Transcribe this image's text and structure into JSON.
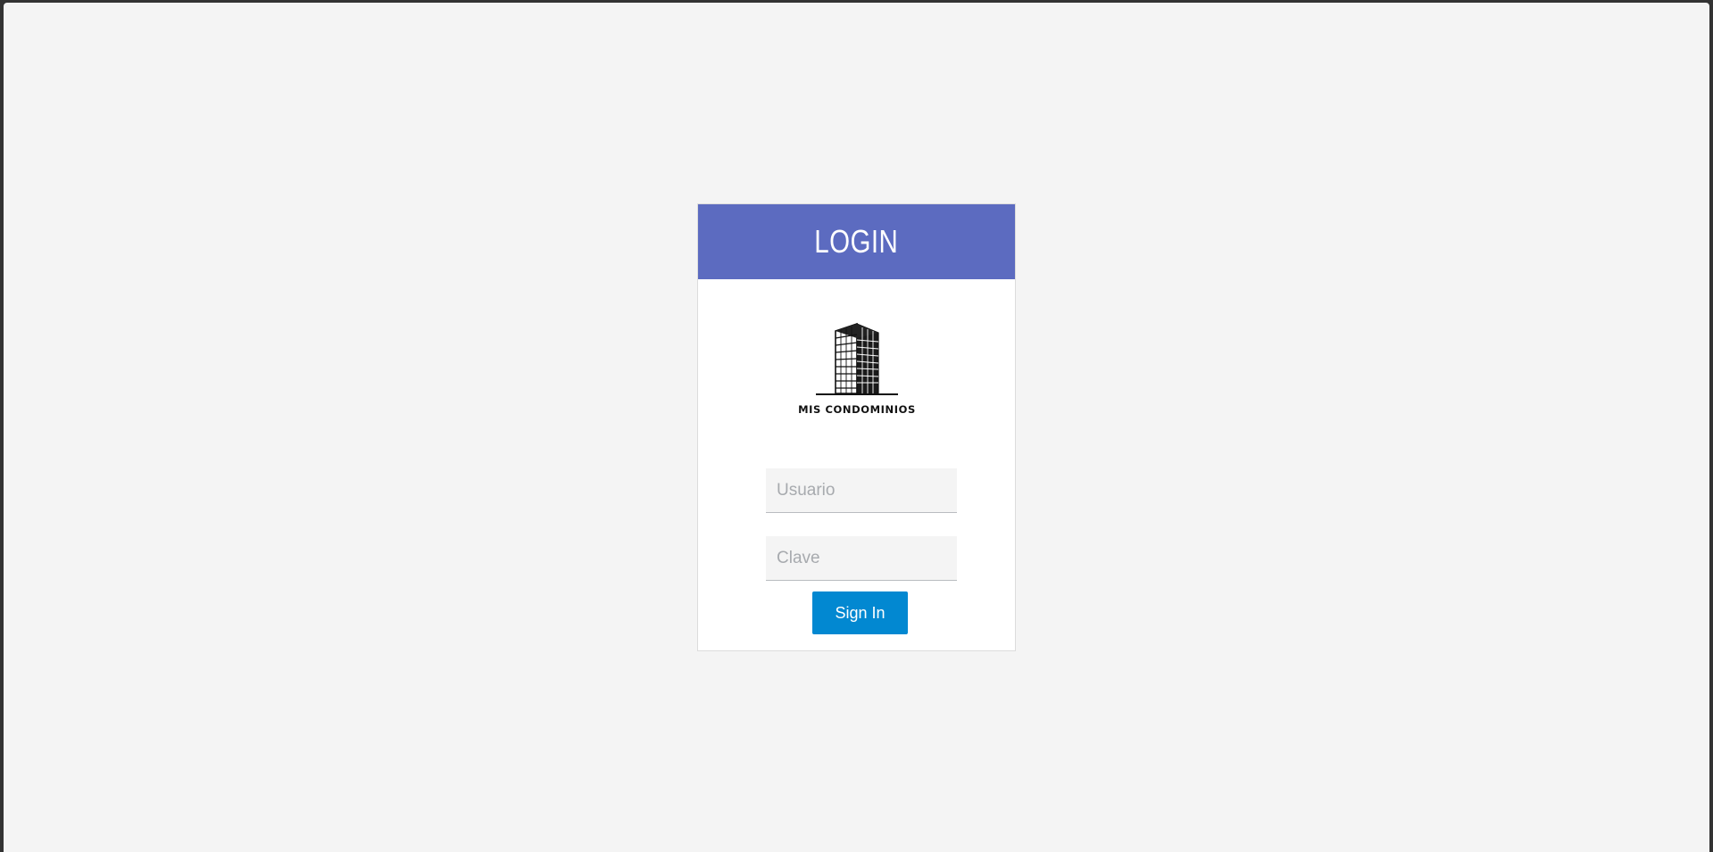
{
  "login": {
    "title": "LOGIN",
    "logo_text": "MIS CONDOMINIOS",
    "username_placeholder": "Usuario",
    "password_placeholder": "Clave",
    "submit_label": "Sign In"
  },
  "colors": {
    "header": "#5c6bc0",
    "button": "#0288d1",
    "page_background": "#f4f4f4",
    "field_background": "#f4f4f4"
  },
  "icons": {
    "logo": "building-icon"
  }
}
